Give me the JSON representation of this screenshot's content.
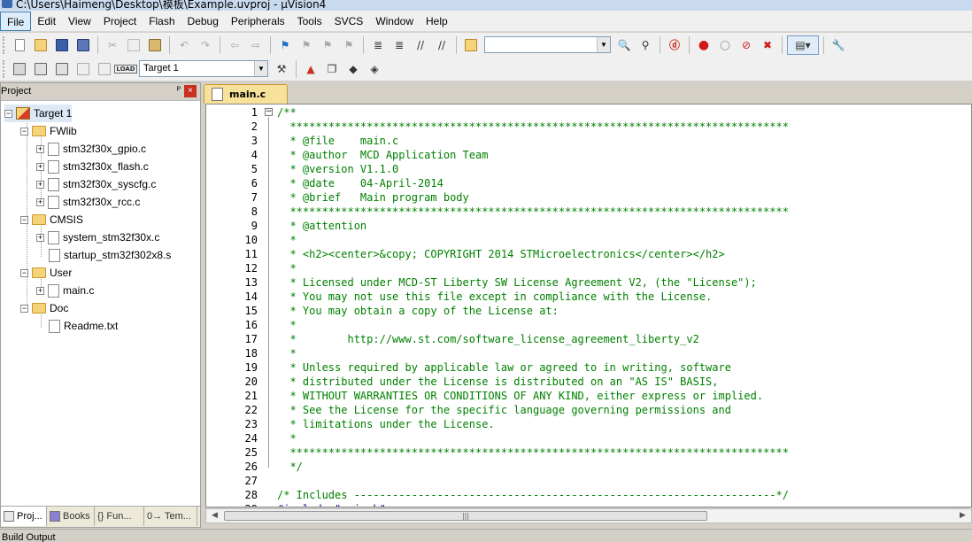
{
  "window": {
    "title": "C:\\Users\\Haimeng\\Desktop\\模板\\Example.uvproj - µVision4"
  },
  "menubar": {
    "items": [
      "File",
      "Edit",
      "View",
      "Project",
      "Flash",
      "Debug",
      "Peripherals",
      "Tools",
      "SVCS",
      "Window",
      "Help"
    ]
  },
  "toolbar2": {
    "target_select": "Target 1",
    "load_label": "LOAD"
  },
  "project_panel": {
    "title": "Project",
    "pin": "ᴾ",
    "close": "×",
    "tree": {
      "target": "Target 1",
      "groups": [
        {
          "name": "FWlib",
          "files": [
            "stm32f30x_gpio.c",
            "stm32f30x_flash.c",
            "stm32f30x_syscfg.c",
            "stm32f30x_rcc.c"
          ]
        },
        {
          "name": "CMSIS",
          "files": [
            "system_stm32f30x.c",
            "startup_stm32f302x8.s"
          ]
        },
        {
          "name": "User",
          "files": [
            "main.c"
          ]
        },
        {
          "name": "Doc",
          "files": [
            "Readme.txt"
          ]
        }
      ]
    },
    "tabs": [
      "Proj...",
      "Books",
      "{} Fun...",
      "0→ Tem..."
    ]
  },
  "editor": {
    "tab": "main.c",
    "lines": [
      "/**",
      "  ******************************************************************************",
      "  * @file    main.c",
      "  * @author  MCD Application Team",
      "  * @version V1.1.0",
      "  * @date    04-April-2014",
      "  * @brief   Main program body",
      "  ******************************************************************************",
      "  * @attention",
      "  *",
      "  * <h2><center>&copy; COPYRIGHT 2014 STMicroelectronics</center></h2>",
      "  *",
      "  * Licensed under MCD-ST Liberty SW License Agreement V2, (the \"License\");",
      "  * You may not use this file except in compliance with the License.",
      "  * You may obtain a copy of the License at:",
      "  *",
      "  *        http://www.st.com/software_license_agreement_liberty_v2",
      "  *",
      "  * Unless required by applicable law or agreed to in writing, software",
      "  * distributed under the License is distributed on an \"AS IS\" BASIS,",
      "  * WITHOUT WARRANTIES OR CONDITIONS OF ANY KIND, either express or implied.",
      "  * See the License for the specific language governing permissions and",
      "  * limitations under the License.",
      "  *",
      "  ******************************************************************************",
      "  */",
      "",
      "/* Includes ------------------------------------------------------------------*/",
      "#include \"main.h\""
    ]
  },
  "status": {
    "build_output": "Build Output"
  }
}
